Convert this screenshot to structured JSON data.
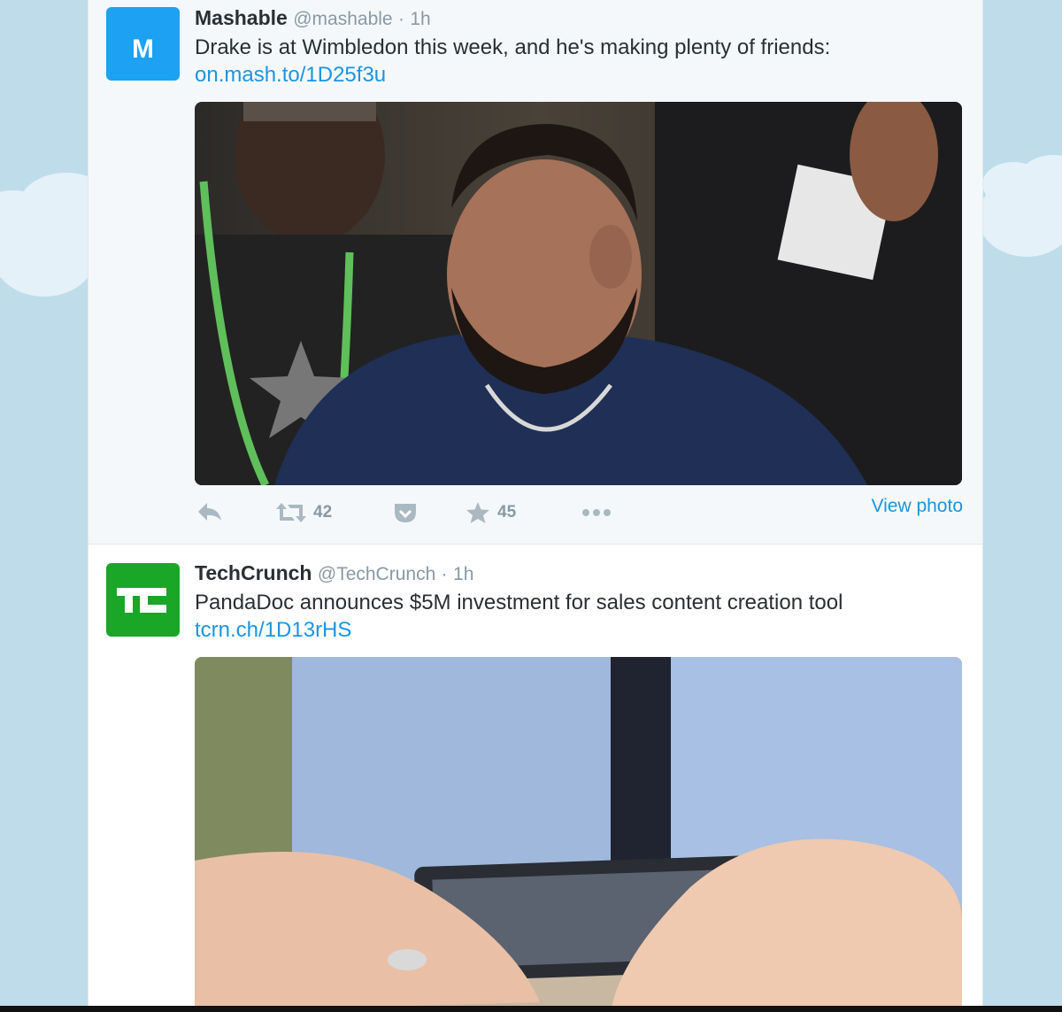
{
  "colors": {
    "link": "#1b95e0",
    "mashable_avatar": "#1da1f2",
    "techcrunch_avatar": "#1aa627",
    "meta": "#8899a6"
  },
  "tweets": [
    {
      "name": "Mashable",
      "handle": "@mashable",
      "separator": "·",
      "time": "1h",
      "avatar_text": "M",
      "text": "Drake is at Wimbledon this week, and he's making plenty of friends:",
      "link": "on.mash.to/1D25f3u",
      "actions": {
        "reply_icon": "reply-icon",
        "retweet_icon": "retweet-icon",
        "retweet_count": "42",
        "pocket_icon": "pocket-icon",
        "favorite_icon": "star-icon",
        "favorite_count": "45",
        "more_icon": "more-icon"
      },
      "view_photo": "View photo"
    },
    {
      "name": "TechCrunch",
      "handle": "@TechCrunch",
      "separator": "·",
      "time": "1h",
      "avatar_text": "TC",
      "text": "PandaDoc announces $5M investment for sales content creation tool",
      "link": "tcrn.ch/1D13rHS"
    }
  ]
}
